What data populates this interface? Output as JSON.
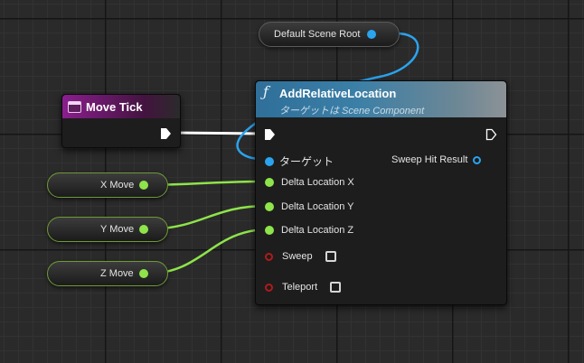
{
  "nodes": {
    "default_scene_root": {
      "label": "Default Scene Root"
    },
    "move_tick": {
      "title": "Move Tick"
    },
    "x_move": {
      "label": "X Move"
    },
    "y_move": {
      "label": "Y Move"
    },
    "z_move": {
      "label": "Z Move"
    },
    "add_relative_location": {
      "icon": "function-icon",
      "icon_glyph": "ƒ",
      "title": "AddRelativeLocation",
      "subtitle": "ターゲットは Scene Component",
      "pins": {
        "target": "ターゲット",
        "sweep_hit_result": "Sweep Hit Result",
        "delta_x": "Delta Location X",
        "delta_y": "Delta Location Y",
        "delta_z": "Delta Location Z",
        "sweep": "Sweep",
        "teleport": "Teleport"
      }
    }
  },
  "colors": {
    "exec_wire": "#ffffff",
    "object_pin": "#2aa4ef",
    "float_pin": "#8ee44a",
    "bool_pin": "#b01a1a",
    "event_header": "#8a1e8e",
    "function_header": "#2f6f99"
  }
}
